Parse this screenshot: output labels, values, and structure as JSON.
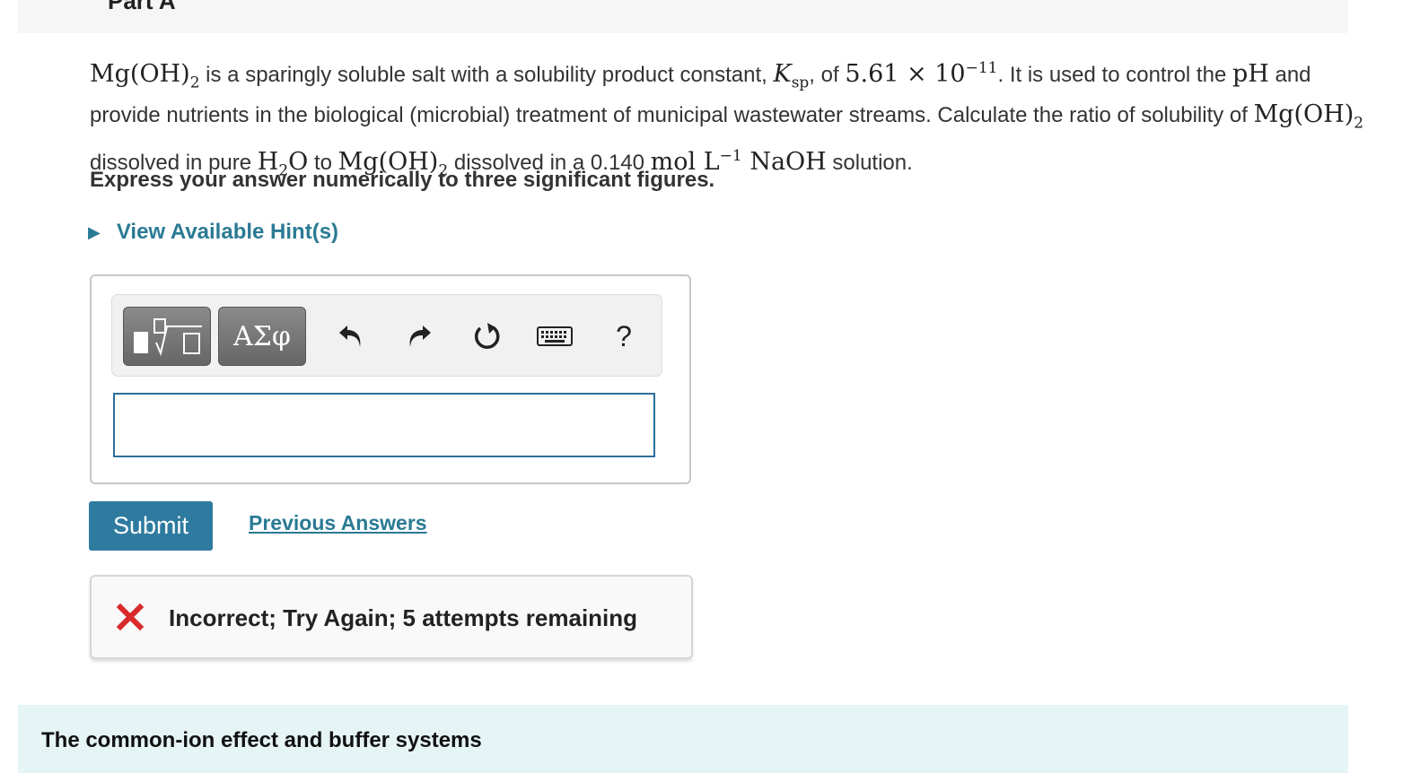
{
  "part": {
    "title": "Part A"
  },
  "question": {
    "formula_mgoh2": "Mg(OH)",
    "sub2": "2",
    "t1": " is a sparingly soluble salt with a solubility product constant, ",
    "k": "K",
    "k_sub": "sp",
    "t2": ", of ",
    "ksp_value": "5.61 × 10",
    "ksp_exp": "−11",
    "t3": ". It is used to control the ",
    "ph": "pH",
    "t4": " and provide nutrients in the biological (microbial) treatment of municipal wastewater streams. Calculate the ratio of solubility of ",
    "t5": " dissolved in pure ",
    "h2o_h": "H",
    "h2o_o": "O",
    "t6": " to ",
    "t7": " dissolved in a 0.140 ",
    "unit": "mol L",
    "unit_exp": "−1",
    "naoh": "NaOH",
    "t8": " solution."
  },
  "instruction": "Express your answer numerically to three significant figures.",
  "hint": {
    "label": "View Available Hint(s)",
    "icon": "triangle-right-icon"
  },
  "toolbar": {
    "greek_label": "ΑΣφ",
    "help_label": "?",
    "icons": [
      "template-icon",
      "undo-icon",
      "redo-icon",
      "reset-icon",
      "keyboard-icon",
      "help-icon"
    ]
  },
  "answer": {
    "value": "",
    "placeholder": ""
  },
  "buttons": {
    "submit": "Submit",
    "previous_answers": "Previous Answers"
  },
  "feedback": {
    "message": "Incorrect; Try Again; 5 attempts remaining",
    "icon": "x-icon",
    "icon_color": "#d92b2b"
  },
  "footer": {
    "title": "The common-ion effect and buffer systems"
  },
  "colors": {
    "accent": "#2a7a94",
    "submit_bg": "#2f7ba0",
    "input_border": "#2c6e9a",
    "footer_bg": "#e5f4f4"
  }
}
